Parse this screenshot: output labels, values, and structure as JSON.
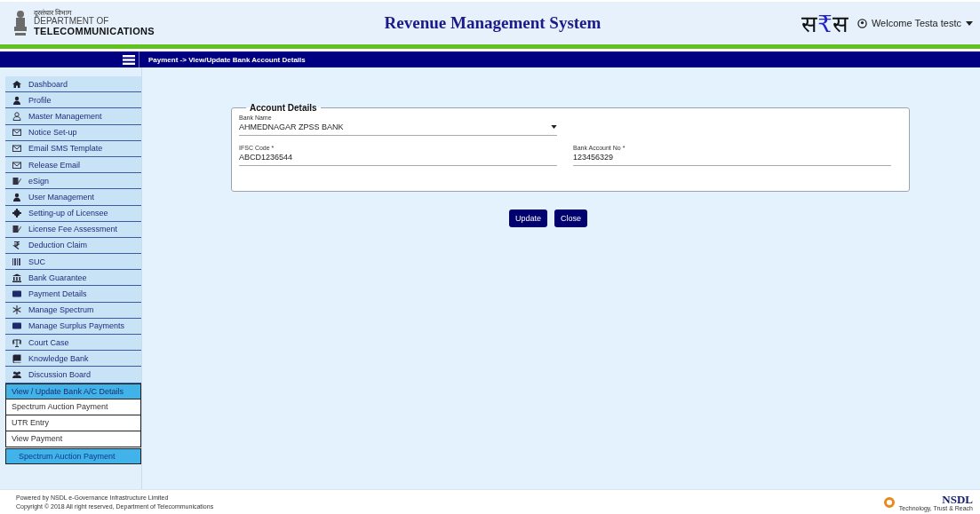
{
  "header": {
    "dept_hindi": "दूरसंचार विभाग",
    "dept_line1": "DEPARTMENT OF",
    "dept_line2": "TELECOMMUNICATIONS",
    "title": "Revenue Management System",
    "logo_text": "स₹स",
    "user": "Welcome Testa testc"
  },
  "breadcrumb": "Payment -> View/Update Bank Account Details",
  "sidebar": {
    "items": [
      {
        "label": "Dashboard"
      },
      {
        "label": "Profile"
      },
      {
        "label": "Master Management"
      },
      {
        "label": "Notice Set-up"
      },
      {
        "label": "Email SMS Template"
      },
      {
        "label": "Release Email"
      },
      {
        "label": "eSign"
      },
      {
        "label": "User Management"
      },
      {
        "label": "Setting-up of Licensee"
      },
      {
        "label": "License Fee Assessment"
      },
      {
        "label": "Deduction Claim"
      },
      {
        "label": "SUC"
      },
      {
        "label": "Bank Guarantee"
      },
      {
        "label": "Payment Details"
      },
      {
        "label": "Manage Spectrum"
      },
      {
        "label": "Manage Surplus Payments"
      },
      {
        "label": "Court Case"
      },
      {
        "label": "Knowledge Bank"
      },
      {
        "label": "Discussion Board"
      }
    ],
    "submenu": [
      {
        "label": "View / Update Bank A/C Details",
        "selected": true
      },
      {
        "label": "Spectrum Auction Payment",
        "selected": false
      },
      {
        "label": "UTR Entry",
        "selected": false
      },
      {
        "label": "View Payment",
        "selected": false,
        "children": [
          {
            "label": "Spectrum Auction Payment",
            "selected": true
          }
        ]
      }
    ]
  },
  "form": {
    "legend": "Account Details",
    "fields": [
      {
        "kind": "select",
        "label": "Bank Name",
        "value": "AHMEDNAGAR ZPSS BANK"
      },
      {
        "kind": "text",
        "label": "IFSC Code *",
        "value": "ABCD1236544"
      },
      {
        "kind": "text",
        "label": "Bank Account No *",
        "value": "123456329"
      }
    ],
    "buttons": [
      "Update",
      "Close"
    ]
  },
  "footer": {
    "line1": "Powered by NSDL e-Governance Infrastructure Limited",
    "line2": "Copyright © 2018 All right reserved, Department of Telecommunications",
    "brand": "NSDL",
    "tagline": "Technology, Trust & Reach"
  }
}
